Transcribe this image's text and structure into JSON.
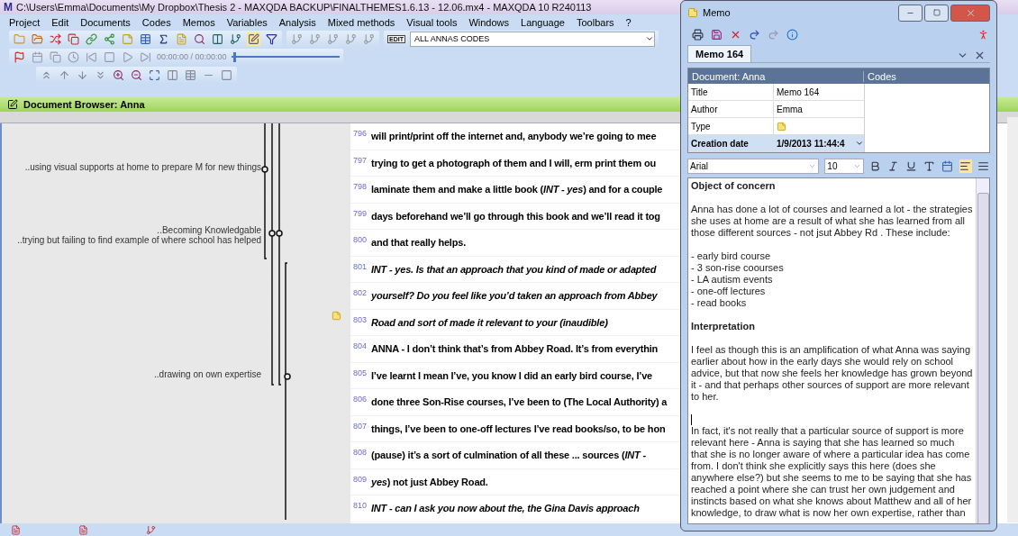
{
  "window": {
    "title": "C:\\Users\\Emma\\Documents\\My Dropbox\\Thesis 2 - MAXQDA BACKUP\\FINALTHEMES1.6.13 - 12.06.mx4 - MAXQDA 10  R240113",
    "logo": "M"
  },
  "menu": [
    {
      "label": "Project"
    },
    {
      "label": "Edit"
    },
    {
      "label": "Documents"
    },
    {
      "label": "Codes"
    },
    {
      "label": "Memos"
    },
    {
      "label": "Variables"
    },
    {
      "label": "Analysis"
    },
    {
      "label": "Mixed methods"
    },
    {
      "label": "Visual tools"
    },
    {
      "label": "Windows"
    },
    {
      "label": "Language"
    },
    {
      "label": "Toolbars"
    },
    {
      "label": "?"
    }
  ],
  "code_set": {
    "edit_label": "EDIT",
    "value": "ALL ANNAS CODES"
  },
  "media": {
    "time": "00:00:00 / 00:00:00",
    "level": 0.02
  },
  "document_browser": {
    "title": "Document Browser: Anna"
  },
  "code_labels": [
    {
      "text": "..using visual supports at home to prepare M for new things"
    },
    {
      "text": "..Becoming Knowledgable"
    },
    {
      "text": "..trying but failing to find example of where school has helped"
    },
    {
      "text": "..drawing on own expertise"
    }
  ],
  "lines": [
    {
      "number": "796",
      "text": "will print/print off the internet and, anybody we’re going to mee",
      "italic": false
    },
    {
      "number": "797",
      "text": "trying to get a photograph of them and I will, erm print them ou",
      "italic": false
    },
    {
      "number": "798",
      "text": "laminate them and make a little book (*INT - yes*) and for a couple",
      "italic": false
    },
    {
      "number": "799",
      "text": "days beforehand we’ll go through this book and we’ll read it tog",
      "italic": false
    },
    {
      "number": "800",
      "text": "and that really helps.",
      "italic": false
    },
    {
      "number": "801",
      "text": "INT - yes.   Is that an approach that you kind of made or adapted",
      "italic": true
    },
    {
      "number": "802",
      "text": "yourself? Do you feel like you’d taken an approach from Abbey",
      "italic": true
    },
    {
      "number": "803",
      "text": "Road  and sort of made it relevant  to your (inaudible)",
      "italic": true,
      "memo": true
    },
    {
      "number": "804",
      "text": "ANNA - I don’t think that’s from Abbey Road.  It’s from everythin",
      "italic": false
    },
    {
      "number": "805",
      "text": "I’ve learnt I mean I’ve, you know I did an early bird course, I’ve",
      "italic": false
    },
    {
      "number": "806",
      "text": "done three Son-Rise courses, I’ve been to (The Local Authority) a",
      "italic": false
    },
    {
      "number": "807",
      "text": "things, I’ve been to one-off lectures I’ve read books/so, to be hon",
      "italic": false
    },
    {
      "number": "808",
      "text": "(pause) it’s a sort of culmination of all these ... sources (*INT -*",
      "italic": false
    },
    {
      "number": "809",
      "text": "*yes*) not just Abbey Road.",
      "italic": false
    },
    {
      "number": "810",
      "text": "INT - can I ask you now about the, the Gina Davis approach",
      "italic": true
    }
  ],
  "memo_window": {
    "title": "Memo",
    "tabs": [
      {
        "label": "Memo 164",
        "selected": true
      }
    ],
    "header": {
      "document": "Document: Anna",
      "codes": "Codes"
    },
    "properties": [
      {
        "label": "Title",
        "value": "Memo 164",
        "selected": false,
        "kind": "text"
      },
      {
        "label": "Author",
        "value": "Emma",
        "selected": false,
        "kind": "text"
      },
      {
        "label": "Type",
        "selected": false,
        "kind": "memo-type"
      },
      {
        "label": "Creation date",
        "value": "1/9/2013 11:44:4",
        "selected": true,
        "kind": "date"
      }
    ],
    "format": {
      "font": "Arial",
      "size": "10",
      "align_left": true,
      "align_justify": false
    },
    "body": [
      {
        "kind": "heading",
        "text": "Object of concern"
      },
      {
        "kind": "para",
        "text": "Anna has done a lot of courses and learned a lot - the strategies she uses at home are a result of what she has learned from all those different sources - not jsut Abbey Rd . These include:"
      },
      {
        "kind": "list",
        "items": [
          "- early bird course",
          "- 3 son-rise coourses",
          "- LA autism events",
          "- one-off lectures",
          "- read books"
        ]
      },
      {
        "kind": "heading",
        "text": "Interpretation"
      },
      {
        "kind": "para",
        "text": "I feel as though this is an amplification of what Anna was saying earlier about how in the early days she would rely on school advice, but that now she feels her knowledge has grown beyond it - and that perhaps other sources of support are more relevant to her."
      },
      {
        "kind": "caret"
      },
      {
        "kind": "para",
        "text": "In fact, it's not really that a particular source of support is more relevant here - Anna is saying that she has learned so much that she is no longer aware of where a particular idea has come from. I don't think she explicitly says this here (does she anywhere else?) but she seems to me to be saying that she has reached a point where she can trust her own judgement and instincts based on what she knows about Matthew and all of her knowledge, to draw what is now her own expertise, rather than"
      }
    ]
  }
}
